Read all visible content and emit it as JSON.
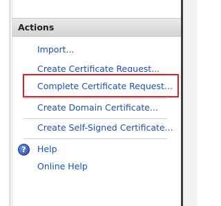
{
  "actions_pane": {
    "header": "Actions",
    "items": [
      {
        "label": "Import..."
      },
      {
        "label": "Create Certificate Request..."
      },
      {
        "label": "Complete Certificate Request..."
      },
      {
        "label": "Create Domain Certificate..."
      },
      {
        "label": "Create Self-Signed Certificate..."
      }
    ],
    "help": {
      "label": "Help",
      "icon": "help-icon"
    },
    "online_help": {
      "label": "Online Help"
    }
  },
  "colors": {
    "link": "#1a4fb3",
    "highlight": "#e31c24",
    "header_bg": "#dcdcdc"
  }
}
